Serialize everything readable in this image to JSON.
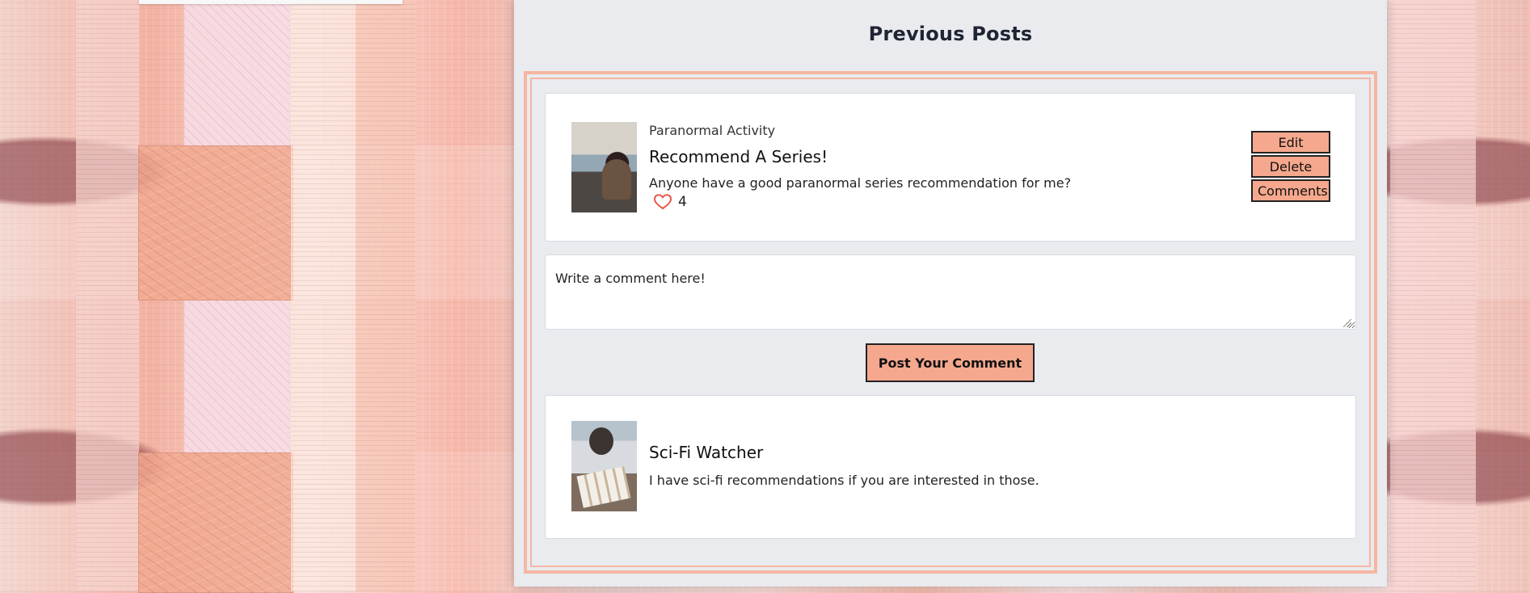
{
  "page": {
    "section_title": "Previous Posts"
  },
  "post": {
    "category": "Paranormal Activity",
    "title": "Recommend A Series!",
    "body": "Anyone have a good paranormal series recommendation for me?",
    "likes": "4",
    "actions": {
      "edit": "Edit",
      "delete": "Delete",
      "comments": "Comments"
    }
  },
  "comment_form": {
    "placeholder": "Write a comment here!",
    "submit_label": "Post Your Comment"
  },
  "comments": [
    {
      "author": "Sci-Fi Watcher",
      "body": "I have sci-fi recommendations if you are interested in those."
    }
  ],
  "colors": {
    "accent": "#f5a88d",
    "frame": "#f5b6a2",
    "heart": "#e9574a",
    "panel": "#e9ebef"
  },
  "icons": {
    "like": "heart-icon"
  }
}
